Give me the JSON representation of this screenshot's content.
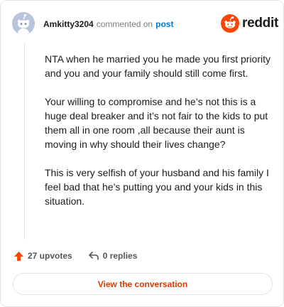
{
  "comment": {
    "username": "Amkitty3204",
    "action_text": "commented on",
    "target_link": "post",
    "paragraphs": [
      "NTA when he married you he made you first priority and you and your family should still come first.",
      "Your willing to compromise and he’s not this is a huge deal breaker and it’s not fair to the kids to put them all in one room ,all because their aunt is moving in why should their lives change?",
      "This is very selfish of your husband and his family I feel bad that he’s putting you and your kids in this situation."
    ]
  },
  "brand": {
    "name": "reddit",
    "icon": "reddit-snoo-icon",
    "color": "#ff4500"
  },
  "stats": {
    "upvotes_label": "27 upvotes",
    "upvote_icon": "upvote-arrow-icon",
    "upvote_color": "#ff4500",
    "replies_label": "0 replies",
    "reply_icon": "reply-arrow-icon"
  },
  "cta": {
    "label": "View the conversation",
    "color": "#d93a00"
  }
}
